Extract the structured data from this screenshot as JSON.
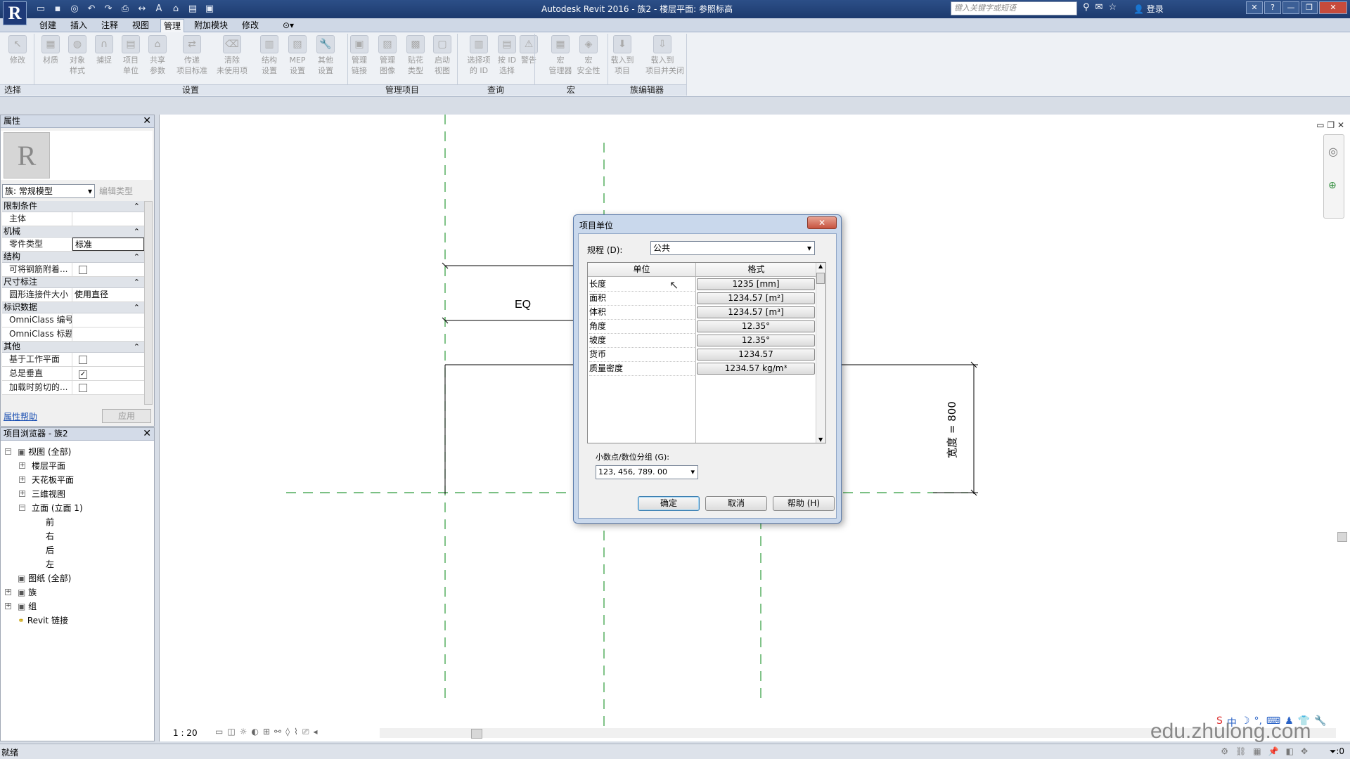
{
  "app": {
    "logo": "R",
    "title": "Autodesk Revit 2016 -    族2 - 楼层平面: 参照标高",
    "search_placeholder": "键入关键字或短语",
    "login": "登录",
    "qat_icons": [
      "open-icon",
      "save-icon",
      "sync-icon",
      "undo-icon",
      "redo-icon",
      "print-icon",
      "measure-icon",
      "text-icon",
      "3d-icon",
      "close-hidden-icon",
      "switch-windows-icon"
    ]
  },
  "tabs": [
    "创建",
    "插入",
    "注释",
    "视图",
    "管理",
    "附加模块",
    "修改"
  ],
  "active_tab": "管理",
  "ribbon": {
    "buttons": [
      {
        "label": "修改",
        "icon": "cursor-icon"
      },
      {
        "label": "材质",
        "icon": "material-icon"
      },
      {
        "label": "对象\n样式",
        "icon": "object-styles-icon"
      },
      {
        "label": "捕捉",
        "icon": "snap-icon"
      },
      {
        "label": "项目\n单位",
        "icon": "units-icon"
      },
      {
        "label": "共享\n参数",
        "icon": "shared-params-icon"
      },
      {
        "label": "传递\n项目标准",
        "icon": "transfer-icon"
      },
      {
        "label": "清除\n未使用项",
        "icon": "purge-icon"
      },
      {
        "label": "结构\n设置",
        "icon": "structural-icon"
      },
      {
        "label": "MEP\n设置",
        "icon": "mep-icon"
      },
      {
        "label": "其他\n设置",
        "icon": "wrench-icon"
      },
      {
        "label": "管理\n链接",
        "icon": "links-icon"
      },
      {
        "label": "管理\n图像",
        "icon": "images-icon"
      },
      {
        "label": "贴花\n类型",
        "icon": "decal-icon"
      },
      {
        "label": "启动\n视图",
        "icon": "starting-view-icon"
      },
      {
        "label": "选择项\n的 ID",
        "icon": "ids-icon"
      },
      {
        "label": "按 ID\n选择",
        "icon": "select-id-icon"
      },
      {
        "label": "警告",
        "icon": "warning-icon"
      },
      {
        "label": "宏\n管理器",
        "icon": "macro-icon"
      },
      {
        "label": "宏\n安全性",
        "icon": "macro-security-icon"
      },
      {
        "label": "载入到\n项目",
        "icon": "load-icon"
      },
      {
        "label": "载入到\n项目并关闭",
        "icon": "load-close-icon"
      }
    ],
    "panels": [
      "选择",
      "设置",
      "管理项目",
      "查询",
      "宏",
      "族编辑器"
    ]
  },
  "properties": {
    "title": "属性",
    "family_type": "族: 常规模型",
    "edit_type": "编辑类型",
    "groups": [
      {
        "name": "限制条件",
        "rows": [
          {
            "name": "主体",
            "value": ""
          }
        ]
      },
      {
        "name": "机械",
        "rows": [
          {
            "name": "零件类型",
            "value": "标准"
          }
        ]
      },
      {
        "name": "结构",
        "rows": [
          {
            "name": "可将钢筋附着...",
            "value": "checkbox-off"
          }
        ]
      },
      {
        "name": "尺寸标注",
        "rows": [
          {
            "name": "圆形连接件大小",
            "value": "使用直径"
          }
        ]
      },
      {
        "name": "标识数据",
        "rows": [
          {
            "name": "OmniClass 编号",
            "value": ""
          },
          {
            "name": "OmniClass 标题",
            "value": ""
          }
        ]
      },
      {
        "name": "其他",
        "rows": [
          {
            "name": "基于工作平面",
            "value": "checkbox-off"
          },
          {
            "name": "总是垂直",
            "value": "checkbox-on"
          },
          {
            "name": "加载时剪切的...",
            "value": "checkbox-off"
          }
        ]
      }
    ],
    "help_link": "属性帮助",
    "apply": "应用"
  },
  "browser": {
    "title": "项目浏览器 - 族2",
    "items": [
      {
        "label": "视图 (全部)",
        "level": 0,
        "expander": "−"
      },
      {
        "label": "楼层平面",
        "level": 1,
        "expander": "+"
      },
      {
        "label": "天花板平面",
        "level": 1,
        "expander": "+"
      },
      {
        "label": "三维视图",
        "level": 1,
        "expander": "+"
      },
      {
        "label": "立面 (立面 1)",
        "level": 1,
        "expander": "−"
      },
      {
        "label": "前",
        "level": 2,
        "expander": ""
      },
      {
        "label": "右",
        "level": 2,
        "expander": ""
      },
      {
        "label": "后",
        "level": 2,
        "expander": ""
      },
      {
        "label": "左",
        "level": 2,
        "expander": ""
      },
      {
        "label": "图纸 (全部)",
        "level": 0,
        "expander": ""
      },
      {
        "label": "族",
        "level": 0,
        "expander": "+"
      },
      {
        "label": "组",
        "level": 0,
        "expander": "+"
      },
      {
        "label": "Revit 链接",
        "level": 0,
        "expander": ""
      }
    ]
  },
  "canvas": {
    "eq_label": "EQ",
    "width_dimension": "宽度 = 800",
    "scale": "1 : 20"
  },
  "dialog": {
    "title": "项目单位",
    "discipline_label": "规程 (D):",
    "discipline_value": "公共",
    "col_unit": "单位",
    "col_format": "格式",
    "units": [
      {
        "name": "长度",
        "format": "1235 [mm]"
      },
      {
        "name": "面积",
        "format": "1234.57 [m²]"
      },
      {
        "name": "体积",
        "format": "1234.57 [m³]"
      },
      {
        "name": "角度",
        "format": "12.35°"
      },
      {
        "name": "坡度",
        "format": "12.35°"
      },
      {
        "name": "货币",
        "format": "1234.57"
      },
      {
        "name": "质量密度",
        "format": "1234.57 kg/m³"
      }
    ],
    "decimal_label": "小数点/数位分组 (G):",
    "decimal_value": "123, 456, 789. 00",
    "ok": "确定",
    "cancel": "取消",
    "help": "帮助 (H)"
  },
  "status": {
    "text": "就绪",
    "filter": ":0",
    "watermark": "edu.zhulong.com"
  }
}
